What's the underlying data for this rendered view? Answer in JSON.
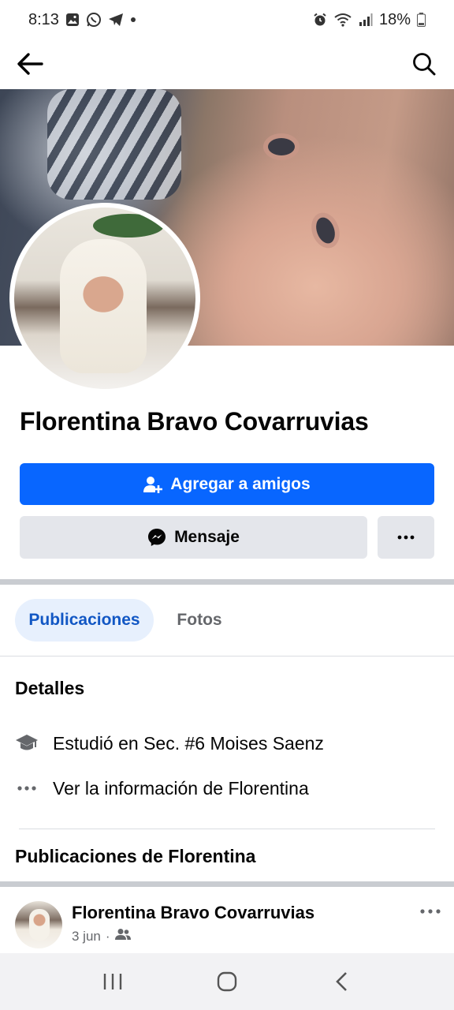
{
  "status_bar": {
    "time": "8:13",
    "battery": "18%",
    "icons": [
      "gallery-icon",
      "whatsapp-icon",
      "telegram-icon",
      "dot-icon",
      "alarm-icon",
      "wifi-icon",
      "signal-icon",
      "battery-icon"
    ]
  },
  "topnav": {
    "back_icon": "back-arrow-icon",
    "search_icon": "search-icon"
  },
  "profile": {
    "name": "Florentina Bravo Covarruvias"
  },
  "actions": {
    "add_friend_label": "Agregar a amigos",
    "message_label": "Mensaje",
    "more_label": "···"
  },
  "tabs": [
    {
      "label": "Publicaciones",
      "active": true
    },
    {
      "label": "Fotos",
      "active": false
    }
  ],
  "details": {
    "title": "Detalles",
    "items": [
      {
        "icon": "graduation-cap-icon",
        "text": "Estudió en Sec. #6 Moises Saenz"
      },
      {
        "icon": "more-dots-icon",
        "text": "Ver la información de Florentina"
      }
    ]
  },
  "posts_section": {
    "title": "Publicaciones de Florentina"
  },
  "post": {
    "author": "Florentina Bravo Covarruvias",
    "date": "3 jun",
    "separator": "·",
    "audience_icon": "friends-icon"
  },
  "colors": {
    "primary": "#0866ff",
    "secondary_bg": "#e4e6eb",
    "tab_active_bg": "#e7f0fd",
    "tab_active_text": "#1257c4",
    "muted_text": "#65676b"
  }
}
